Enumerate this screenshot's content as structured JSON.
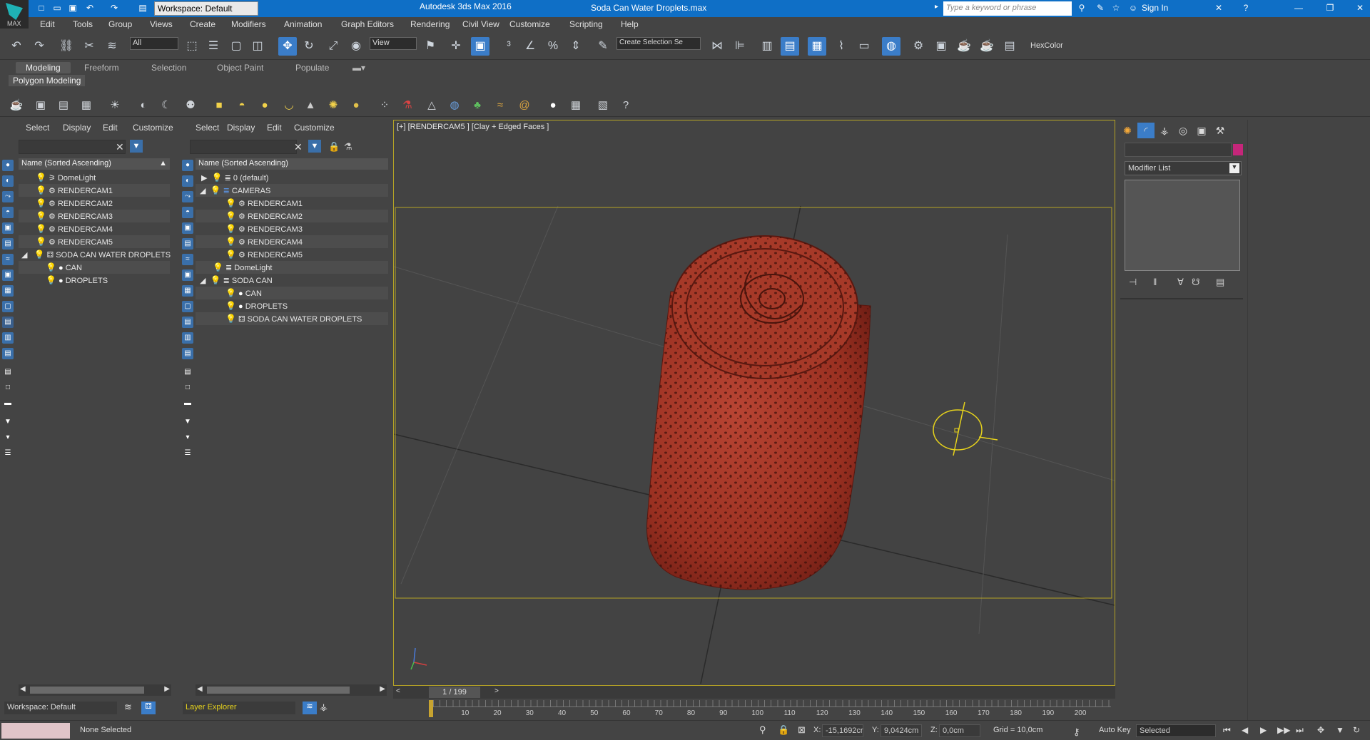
{
  "app": {
    "title": "Autodesk 3ds Max 2016",
    "file": "Soda Can Water Droplets.max",
    "workspace": "Workspace: Default",
    "search_placeholder": "Type a keyword or phrase",
    "signin": "Sign In",
    "logo_text": "MAX"
  },
  "menu": [
    "Edit",
    "Tools",
    "Group",
    "Views",
    "Create",
    "Modifiers",
    "Animation",
    "Graph Editors",
    "Rendering",
    "Civil View",
    "Customize",
    "Scripting",
    "Help"
  ],
  "toolbar": {
    "filter_value": "All",
    "ref_coord": "View",
    "selection_set_placeholder": "Create Selection Se",
    "hexcolor_label": "HexColor"
  },
  "ribbon": {
    "tabs": [
      "Modeling",
      "Freeform",
      "Selection",
      "Object Paint",
      "Populate"
    ],
    "active": "Modeling",
    "panel": "Polygon Modeling"
  },
  "explorer_left": {
    "menu": [
      "Select",
      "Display",
      "Edit",
      "Customize"
    ],
    "header": "Name (Sorted Ascending)",
    "rows": [
      {
        "label": "DomeLight",
        "indent": 0
      },
      {
        "label": "RENDERCAM1",
        "indent": 0
      },
      {
        "label": "RENDERCAM2",
        "indent": 0
      },
      {
        "label": "RENDERCAM3",
        "indent": 0
      },
      {
        "label": "RENDERCAM4",
        "indent": 0
      },
      {
        "label": "RENDERCAM5",
        "indent": 0
      },
      {
        "label": "SODA CAN WATER DROPLETS",
        "indent": 0,
        "expanded": true
      },
      {
        "label": "CAN",
        "indent": 1
      },
      {
        "label": "DROPLETS",
        "indent": 1
      }
    ],
    "footer": "Workspace: Default"
  },
  "explorer_right": {
    "menu": [
      "Select",
      "Display",
      "Edit",
      "Customize"
    ],
    "header": "Name (Sorted Ascending)",
    "rows": [
      {
        "label": "0 (default)",
        "indent": 0
      },
      {
        "label": "CAMERAS",
        "indent": 0,
        "expanded": true
      },
      {
        "label": "RENDERCAM1",
        "indent": 1
      },
      {
        "label": "RENDERCAM2",
        "indent": 1
      },
      {
        "label": "RENDERCAM3",
        "indent": 1
      },
      {
        "label": "RENDERCAM4",
        "indent": 1
      },
      {
        "label": "RENDERCAM5",
        "indent": 1
      },
      {
        "label": "DomeLight",
        "indent": 0
      },
      {
        "label": "SODA CAN",
        "indent": 0,
        "expanded": true
      },
      {
        "label": "CAN",
        "indent": 1
      },
      {
        "label": "DROPLETS",
        "indent": 1
      },
      {
        "label": "SODA CAN WATER DROPLETS",
        "indent": 1
      }
    ],
    "footer": "Layer Explorer"
  },
  "viewport": {
    "label": "[+] [RENDERCAM5 ] [Clay + Edged Faces ]"
  },
  "command_panel": {
    "modifier_list": "Modifier List"
  },
  "timeline": {
    "frame": "1 / 199",
    "ticks": [
      "10",
      "20",
      "30",
      "40",
      "50",
      "60",
      "70",
      "80",
      "90",
      "100",
      "110",
      "120",
      "130",
      "140",
      "150",
      "160",
      "170",
      "180",
      "190",
      "200"
    ]
  },
  "status": {
    "selection": "None Selected",
    "x_label": "X:",
    "x_value": "-15,1692cr",
    "y_label": "Y:",
    "y_value": "9,0424cm",
    "z_label": "Z:",
    "z_value": "0,0cm",
    "grid": "Grid = 10,0cm",
    "autokey": "Auto Key",
    "key_mode": "Selected"
  },
  "colors": {
    "title_bar": "#0f6fc6",
    "accent": "#3b7dc8",
    "viewport_frame": "#b5a325",
    "can": "#a23a2a"
  }
}
